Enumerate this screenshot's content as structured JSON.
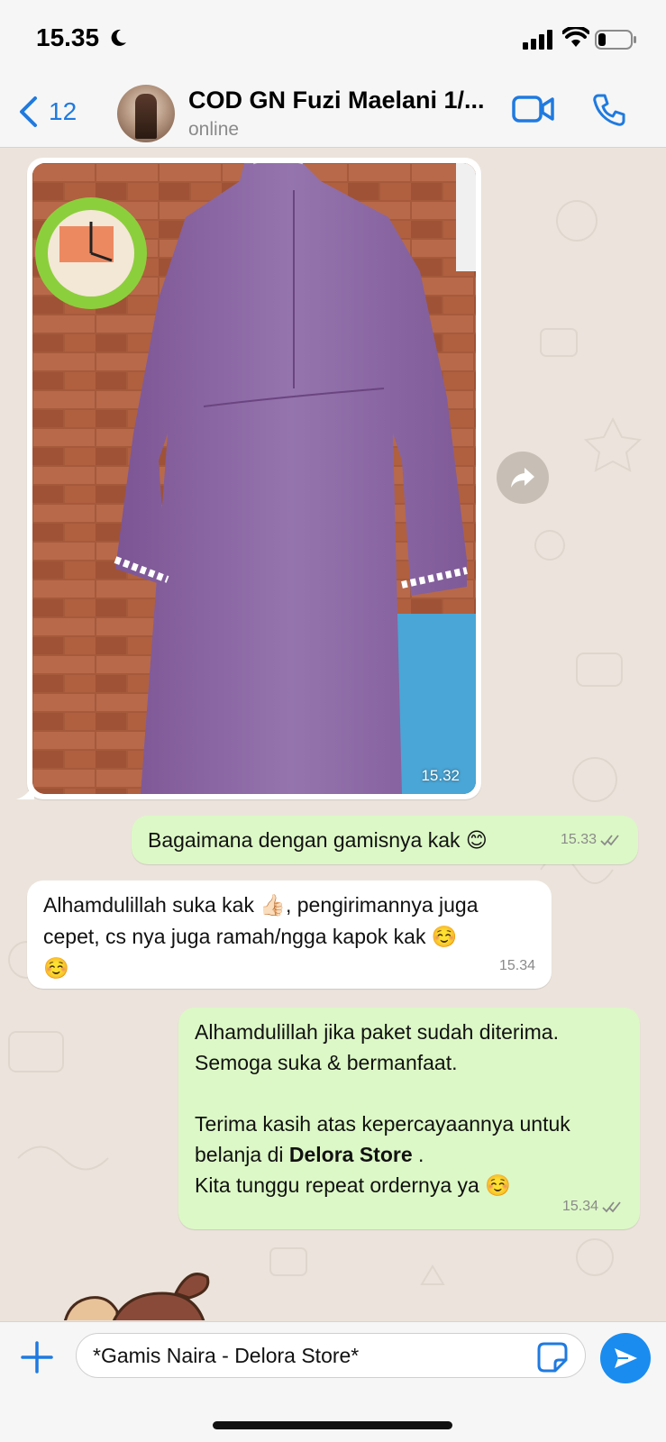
{
  "status_bar": {
    "time": "15.35",
    "icons": [
      "moon-icon",
      "signal-icon",
      "wifi-icon",
      "battery-icon"
    ]
  },
  "header": {
    "back_count": "12",
    "contact_name": "COD GN Fuzi Maelani 1/...",
    "contact_status": "online",
    "icons": [
      "chevron-left-icon",
      "video-call-icon",
      "phone-call-icon"
    ]
  },
  "messages": [
    {
      "type": "image",
      "direction": "incoming",
      "time": "15.32"
    },
    {
      "type": "text",
      "direction": "outgoing",
      "text": "Bagaimana dengan gamisnya kak",
      "emoji": "😊",
      "time": "15.33",
      "status": "read"
    },
    {
      "type": "text",
      "direction": "incoming",
      "line1a": "Alhamdulillah suka kak",
      "emoji1": "👍🏻",
      "line1b": ", pengirimannya juga",
      "line2": "cepet, cs nya juga ramah/ngga kapok kak",
      "emoji2": "☺️",
      "emoji3": "☺️",
      "time": "15.34"
    },
    {
      "type": "text",
      "direction": "outgoing",
      "line1": "Alhamdulillah jika paket sudah diterima.",
      "line2": "Semoga suka & bermanfaat.",
      "line3": "Terima kasih atas kepercayaannya untuk",
      "line4a": "belanja di",
      "line4b": "Delora Store",
      "line4c": ".",
      "line5": "Kita tunggu repeat ordernya ya",
      "emoji": "☺️",
      "time": "15.34",
      "status": "read"
    }
  ],
  "composer": {
    "input_value": "*Gamis Naira - Delora Store*",
    "icons": [
      "plus-icon",
      "sticker-icon",
      "send-icon"
    ]
  },
  "colors": {
    "accent": "#1f7ae0",
    "outgoing_bubble": "#dcf8c6",
    "incoming_bubble": "#ffffff",
    "wallpaper": "#ece4dc"
  }
}
